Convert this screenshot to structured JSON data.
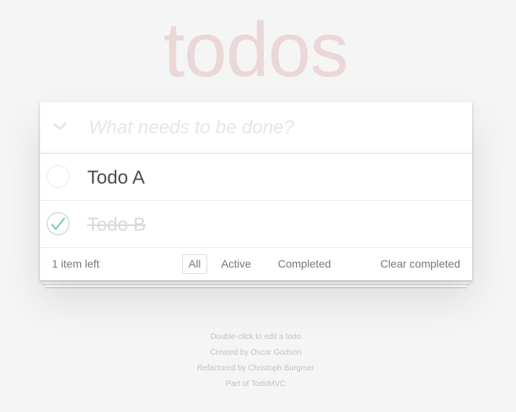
{
  "app": {
    "title": "todos"
  },
  "header": {
    "toggle_all_icon": "chevron-down-icon",
    "new_todo_placeholder": "What needs to be done?",
    "new_todo_value": ""
  },
  "todos": [
    {
      "label": "Todo A",
      "completed": false
    },
    {
      "label": "Todo B",
      "completed": true
    }
  ],
  "footer": {
    "count_text": "1 item left",
    "filters": [
      {
        "label": "All",
        "selected": true
      },
      {
        "label": "Active",
        "selected": false
      },
      {
        "label": "Completed",
        "selected": false
      }
    ],
    "clear_completed_label": "Clear completed"
  },
  "info": {
    "line1": "Double-click to edit a todo",
    "line2": "Created by Oscar Godson",
    "line3": "Refactored by Christoph Burgmer",
    "line4": "Part of TodoMVC"
  },
  "colors": {
    "title": "#efd5d5",
    "check_green": "#5dc2af",
    "background": "#f5f5f5"
  }
}
